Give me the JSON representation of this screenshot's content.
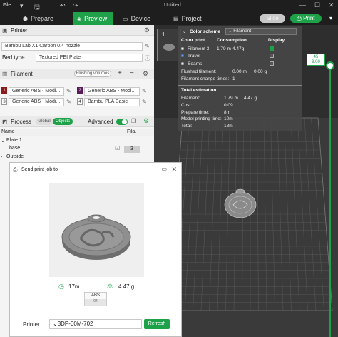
{
  "titlebar": {
    "file_menu": "File",
    "title": "Untitled"
  },
  "tabs": {
    "prepare": "Prepare",
    "preview": "Preview",
    "device": "Device",
    "project": "Project"
  },
  "actions": {
    "slice": "Slice",
    "print": "Print"
  },
  "printer": {
    "heading": "Printer",
    "name": "Bambu Lab X1 Carbon 0.4 nozzle",
    "bed_label": "Bed type",
    "bed_value": "Textured PEI Plate"
  },
  "filament": {
    "heading": "Filament",
    "flushing": "Flushing volumes",
    "slots": [
      {
        "num": "1",
        "color": "#8b1a1a",
        "label": "Generic ABS - Modi..."
      },
      {
        "num": "2",
        "color": "#5a1a5a",
        "label": "Generic ABS - Modi..."
      },
      {
        "num": "3",
        "color": "#ffffff",
        "label": "Generic ABS - Modi..."
      },
      {
        "num": "4",
        "color": "#ffffff",
        "label": "Bambu PLA Basic"
      }
    ]
  },
  "process": {
    "heading": "Process",
    "global": "Global",
    "objects": "Objects",
    "advanced": "Advanced",
    "col_name": "Name",
    "col_fila": "Fila.",
    "rows": [
      {
        "name": "Plate 1",
        "fila": ""
      },
      {
        "name": "base",
        "fila": "3"
      },
      {
        "name": "Outside",
        "fila": ""
      }
    ]
  },
  "dialog": {
    "title": "Send print job to",
    "time": "17m",
    "weight": "4.47 g",
    "filament_tag": "ABS",
    "filament_sub": "04",
    "printer_label": "Printer",
    "printer_value": "3DP-00M-702",
    "refresh": "Refresh"
  },
  "plate": {
    "number": "1"
  },
  "legend": {
    "color_scheme_label": "Color scheme",
    "color_scheme_value": "Filament",
    "col_print": "Color print",
    "col_consumption": "Consumption",
    "col_display": "Display",
    "items": [
      {
        "name": "Filament 3",
        "len": "1.79 m",
        "weight": "4.47g"
      },
      {
        "name": "Travel"
      },
      {
        "name": "Seams"
      }
    ],
    "flushed_label": "Flushed filament:",
    "flushed_len": "0.00 m",
    "flushed_g": "0.00 g",
    "changes_label": "Filament change times:",
    "changes_val": "1",
    "total_heading": "Total estimation",
    "totals": [
      {
        "label": "Filament:",
        "a": "1.79 m",
        "b": "4.47 g"
      },
      {
        "label": "Cost:",
        "a": "0.09",
        "b": ""
      },
      {
        "label": "Prepare time:",
        "a": "8m",
        "b": ""
      },
      {
        "label": "Model printing time:",
        "a": "10m",
        "b": ""
      },
      {
        "label": "Total:",
        "a": "18m",
        "b": ""
      }
    ]
  },
  "layer": {
    "top": "45",
    "height": "9.00"
  },
  "colors": {
    "accent": "#1fa14a",
    "viewport": "#2e2e2e",
    "panel": "#f4f4f4"
  }
}
